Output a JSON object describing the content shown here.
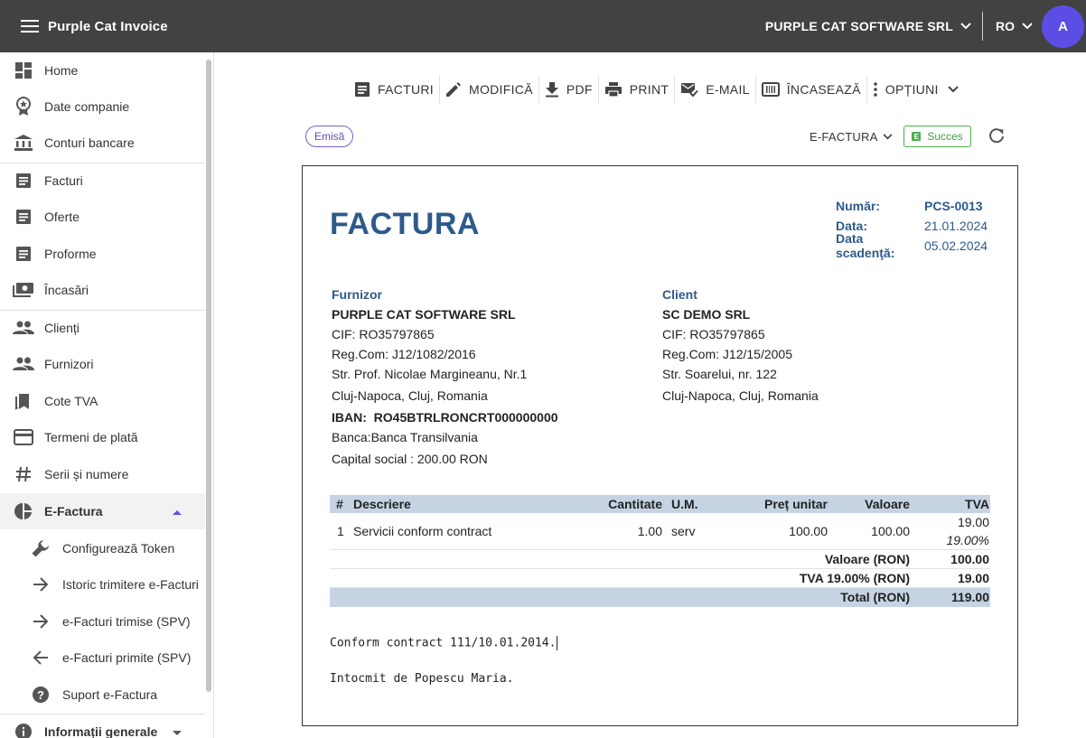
{
  "app": {
    "title": "Purple Cat Invoice"
  },
  "header": {
    "company": "PURPLE CAT SOFTWARE SRL",
    "language": "RO",
    "avatar_initial": "A"
  },
  "sidebar": {
    "items": [
      {
        "label": "Home"
      },
      {
        "label": "Date companie"
      },
      {
        "label": "Conturi bancare"
      },
      {
        "label": "Facturi"
      },
      {
        "label": "Oferte"
      },
      {
        "label": "Proforme"
      },
      {
        "label": "Încasări"
      },
      {
        "label": "Clienți"
      },
      {
        "label": "Furnizori"
      },
      {
        "label": "Cote TVA"
      },
      {
        "label": "Termeni de plată"
      },
      {
        "label": "Serii și numere"
      },
      {
        "label": "E-Factura"
      },
      {
        "label": "Configurează Token"
      },
      {
        "label": "Istoric trimitere e-Facturi"
      },
      {
        "label": "e-Facturi trimise (SPV)"
      },
      {
        "label": "e-Facturi primite (SPV)"
      },
      {
        "label": "Suport e-Factura"
      },
      {
        "label": "Informații generale"
      }
    ]
  },
  "toolbar": {
    "facturi": "FACTURI",
    "modifica": "MODIFICĂ",
    "pdf": "PDF",
    "print": "PRINT",
    "email": "E-MAIL",
    "incaseaza": "ÎNCASEAZĂ",
    "optiuni": "OPȚIUNI"
  },
  "status": {
    "chip": "Emisă",
    "efactura_label": "E-FACTURA",
    "efactura_status": "Succes"
  },
  "invoice": {
    "title": "FACTURA",
    "meta": {
      "numar_label": "Număr:",
      "numar": "PCS-0013",
      "data_label": "Data:",
      "data": "21.01.2024",
      "scadenta_label": "Data scadenţă:",
      "scadenta": "05.02.2024"
    },
    "furnizor": {
      "heading": "Furnizor",
      "name": "PURPLE CAT SOFTWARE SRL",
      "cif": "CIF: RO35797865",
      "regcom": "Reg.Com: J12/1082/2016",
      "address": "Str. Prof. Nicolae Margineanu, Nr.1",
      "city": "Cluj-Napoca, Cluj, Romania",
      "iban_label": "IBAN:",
      "iban": "RO45BTRLRONCRT000000000",
      "banca_label": "Banca:",
      "banca": "Banca Transilvania",
      "capital": "Capital social : 200.00 RON"
    },
    "client": {
      "heading": "Client",
      "name": "SC DEMO SRL",
      "cif": "CIF: RO35797865",
      "regcom": "Reg.Com: J12/15/2005",
      "address": "Str. Soarelui, nr. 122",
      "city": "Cluj-Napoca, Cluj, Romania"
    },
    "columns": {
      "nr": "#",
      "desc": "Descriere",
      "qty": "Cantitate",
      "um": "U.M.",
      "price": "Preț unitar",
      "value": "Valoare",
      "tva": "TVA"
    },
    "rows": [
      {
        "nr": "1",
        "desc": "Servicii conform contract",
        "qty": "1.00",
        "um": "serv",
        "price": "100.00",
        "value": "100.00",
        "tva": "19.00",
        "tva_rate": "19.00%"
      }
    ],
    "totals": {
      "valoare_label": "Valoare (RON)",
      "valoare": "100.00",
      "tva_label": "TVA 19.00% (RON)",
      "tva": "19.00",
      "total_label": "Total (RON)",
      "total": "119.00"
    },
    "notes": [
      "Conform contract 111/10.01.2014.",
      "Intocmit de Popescu Maria."
    ]
  }
}
